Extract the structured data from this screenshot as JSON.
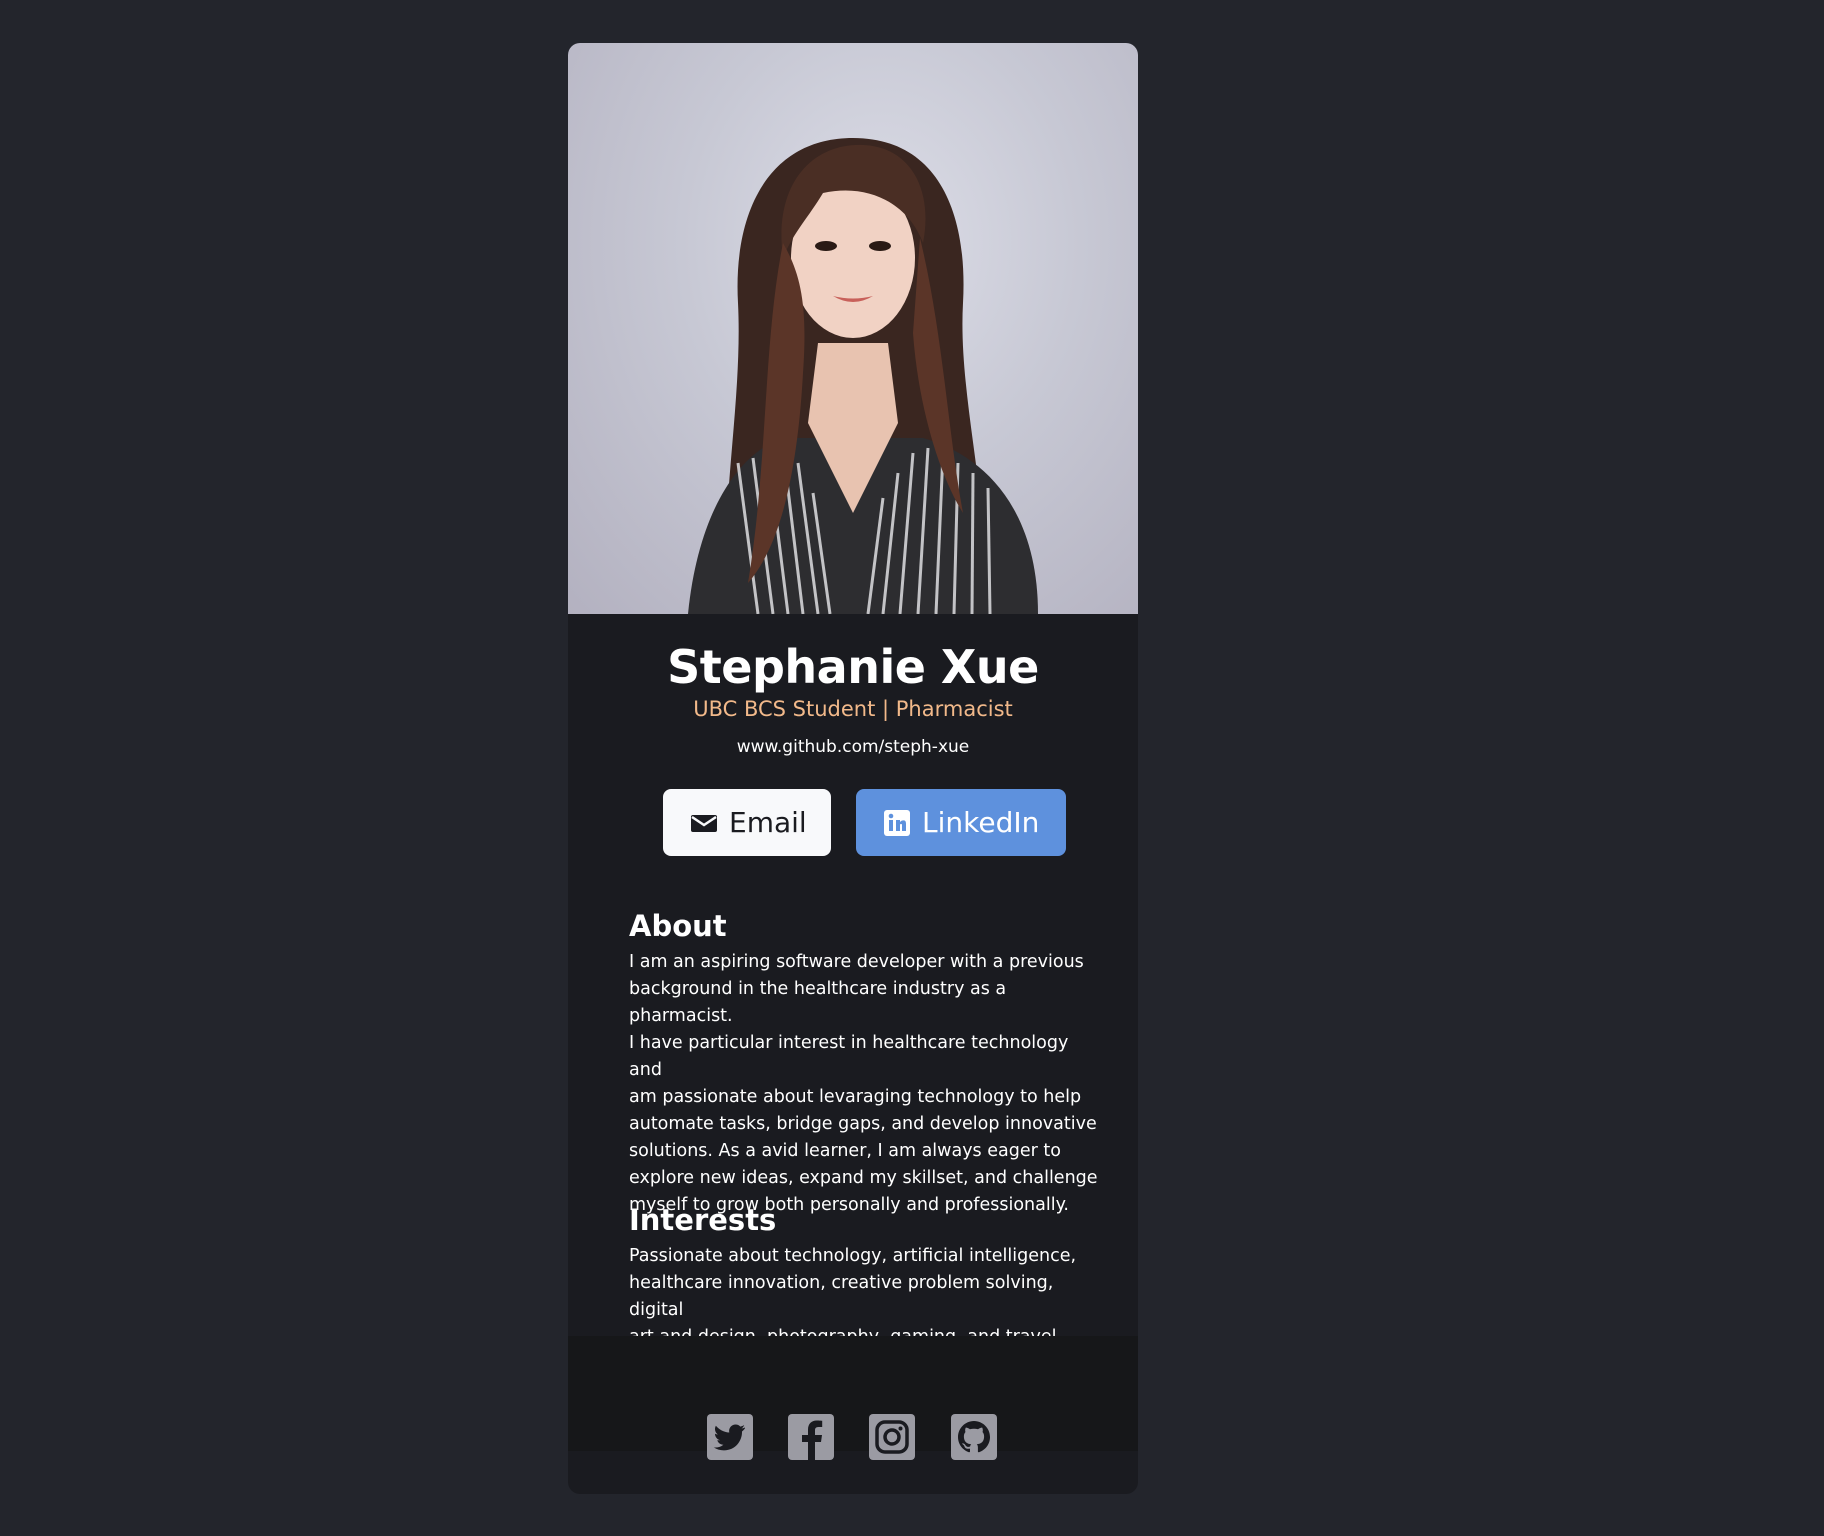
{
  "profile": {
    "name": "Stephanie Xue",
    "subtitle": "UBC BCS Student | Pharmacist",
    "website": "www.github.com/steph-xue",
    "photo_alt": "profile-photo"
  },
  "buttons": {
    "email_label": "Email",
    "linkedin_label": "LinkedIn"
  },
  "about": {
    "title": "About",
    "lines": [
      "I am an aspiring software developer with a previous",
      "background in the healthcare industry as a pharmacist.",
      "I have particular interest in healthcare technology and",
      "am passionate about levaraging technology to help",
      "automate tasks, bridge gaps, and develop innovative",
      "solutions. As a avid learner, I am always eager to",
      "explore new ideas, expand my skillset, and challenge",
      "myself to grow both personally and professionally."
    ]
  },
  "interests": {
    "title": "Interests",
    "lines": [
      "Passionate about technology, artificial intelligence,",
      "healthcare innovation, creative problem solving, digital",
      "art and design, photography, gaming, and travel."
    ]
  },
  "footer": {
    "icons": [
      "twitter-icon",
      "facebook-icon",
      "instagram-icon",
      "github-icon"
    ]
  },
  "colors": {
    "page_bg": "#23252c",
    "card_bg": "#1a1b20",
    "footer_bg": "#161719",
    "accent_subtitle": "#f2b98a",
    "linkedin_blue": "#5e91dd",
    "social_icon_gray": "#9b9ba3"
  }
}
